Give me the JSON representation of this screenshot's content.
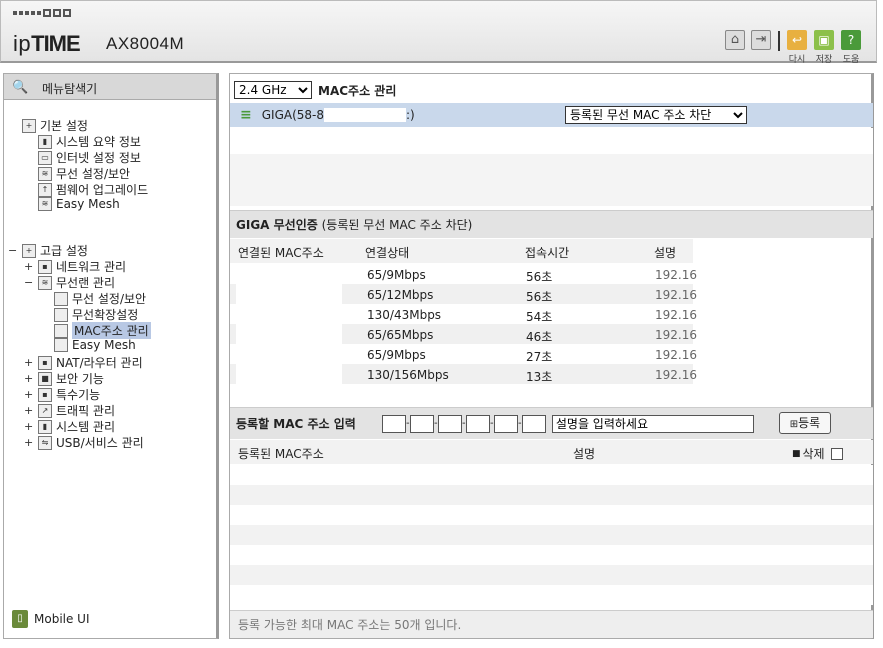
{
  "header": {
    "brand_prefix": "ip",
    "brand_bold": "TIME",
    "model": "AX8004M",
    "buttons": [
      {
        "name": "home-icon",
        "label": ""
      },
      {
        "name": "logout-icon",
        "label": ""
      },
      {
        "name": "exit-icon",
        "label": "다시"
      },
      {
        "name": "save-icon",
        "label": "저장"
      },
      {
        "name": "help-icon",
        "label": "도움"
      }
    ]
  },
  "sidebar": {
    "search_label": "메뉴탐색기",
    "basic": {
      "label": "기본 설정",
      "items": [
        "시스템 요약 정보",
        "인터넷 설정 정보",
        "무선 설정/보안",
        "펌웨어 업그레이드",
        "Easy Mesh"
      ]
    },
    "advanced": {
      "label": "고급 설정",
      "items": [
        "네트워크 관리",
        "무선랜 관리",
        "NAT/라우터 관리",
        "보안 기능",
        "특수기능",
        "트래픽 관리",
        "시스템 관리",
        "USB/서비스 관리"
      ],
      "wireless_sub": [
        "무선 설정/보안",
        "무선확장설정",
        "MAC주소 관리",
        "Easy Mesh"
      ]
    },
    "mobile_label": "Mobile UI"
  },
  "main": {
    "band_select": "2.4 GHz",
    "title": "MAC주소 관리",
    "ssid": "GIGA(58-8",
    "ssid_suffix": ":)",
    "policy_select": "등록된 무선 MAC 주소 차단",
    "auth_title": "GIGA 무선인증",
    "auth_subtitle": "(등록된 무선 MAC 주소 차단)",
    "conn_headers": [
      "연결된 MAC주소",
      "연결상태",
      "접속시간",
      "설명"
    ],
    "conn_rows": [
      {
        "status": "65/9Mbps",
        "time": "56초",
        "desc": "192.16"
      },
      {
        "status": "65/12Mbps",
        "time": "56초",
        "desc": "192.16"
      },
      {
        "status": "130/43Mbps",
        "time": "54초",
        "desc": "192.16"
      },
      {
        "status": "65/65Mbps",
        "time": "46초",
        "desc": "192.16"
      },
      {
        "status": "65/9Mbps",
        "time": "27초",
        "desc": "192.16"
      },
      {
        "status": "130/156Mbps",
        "time": "13초",
        "desc": "192.16"
      }
    ],
    "input_label": "등록할 MAC 주소 입력",
    "desc_placeholder": "설명을 입력하세요",
    "register_label": "등록",
    "reg_headers": [
      "등록된 MAC주소",
      "설명",
      "삭제"
    ],
    "footer": "등록 가능한 최대 MAC 주소는 50개 입니다."
  }
}
